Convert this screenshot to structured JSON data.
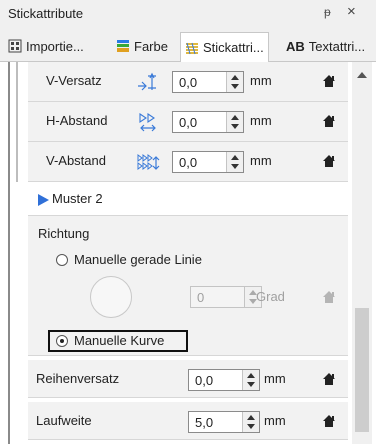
{
  "window": {
    "title": "Stickattribute",
    "pin_glyph": "ᵽ",
    "close_glyph": "×"
  },
  "tabs": [
    {
      "label": "Importie...",
      "icon": "import-icon"
    },
    {
      "label": "Farbe",
      "icon": "color-icon"
    },
    {
      "label": "Stickattri...",
      "icon": "stitch-icon",
      "active": true
    },
    {
      "label": "Textattri...",
      "icon": "text-attr-icon",
      "prefix": "AB"
    }
  ],
  "rows_top": [
    {
      "label": "V-Versatz",
      "value": "0,0",
      "unit": "mm",
      "icon": "v-offset-icon"
    },
    {
      "label": "H-Abstand",
      "value": "0,0",
      "unit": "mm",
      "icon": "h-spacing-icon"
    },
    {
      "label": "V-Abstand",
      "value": "0,0",
      "unit": "mm",
      "icon": "v-spacing-icon"
    }
  ],
  "muster": {
    "label": "Muster 2"
  },
  "richtung": {
    "label": "Richtung",
    "option_line": "Manuelle gerade Linie",
    "option_curve": "Manuelle Kurve",
    "angle_value": "0",
    "angle_unit": "Grad",
    "selected": "curve"
  },
  "rows_bottom": [
    {
      "label": "Reihenversatz",
      "value": "0,0",
      "unit": "mm"
    },
    {
      "label": "Laufweite",
      "value": "5,0",
      "unit": "mm"
    }
  ],
  "colors": {
    "accent": "#3070d8",
    "home": "#222222"
  }
}
